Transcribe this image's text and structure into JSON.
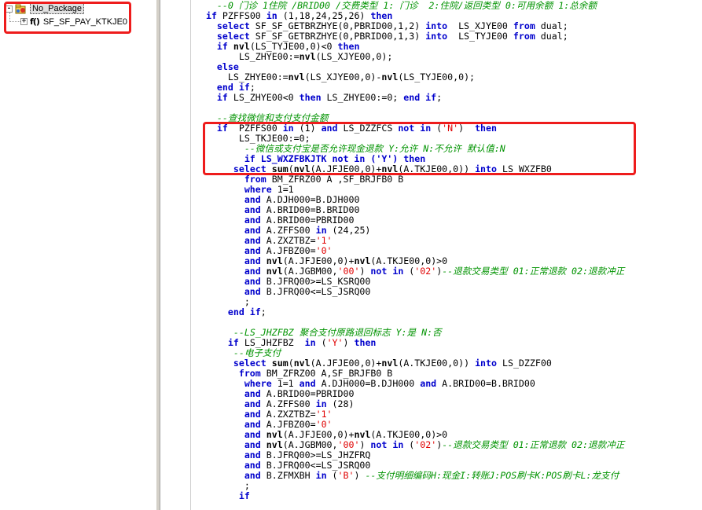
{
  "tree": {
    "package_label": "No_Package",
    "package_expander": "-",
    "procedure_expander": "+",
    "procedure_icon": "f()",
    "procedure_label": "SF_SF_PAY_KTKJE0"
  },
  "colors": {
    "highlight": "#ee1c1c",
    "keyword": "#0000cc",
    "string": "#e00000",
    "comment": "#009300"
  },
  "code_lines": [
    [
      [
        "    ",
        ""
      ],
      [
        "--0 门诊 1住院 /BRID00 /交费类型 1: 门诊  2:住院/返回类型 0:可用余额 1:总余额",
        "cm"
      ]
    ],
    [
      [
        "  ",
        ""
      ],
      [
        "if",
        "kw"
      ],
      [
        " PZFFS00 ",
        ""
      ],
      [
        "in",
        "kw"
      ],
      [
        " (1,18,24,25,26) ",
        ""
      ],
      [
        "then",
        "kw"
      ]
    ],
    [
      [
        "    ",
        ""
      ],
      [
        "select",
        "kw"
      ],
      [
        " SF_SF_GETBRZHYE(0,PBRID00,1,2) ",
        ""
      ],
      [
        "into",
        "kw"
      ],
      [
        "  LS_XJYE00 ",
        ""
      ],
      [
        "from",
        "kw"
      ],
      [
        " dual;",
        ""
      ]
    ],
    [
      [
        "    ",
        ""
      ],
      [
        "select",
        "kw"
      ],
      [
        " SF_SF_GETBRZHYE(0,PBRID00,1,3) ",
        ""
      ],
      [
        "into",
        "kw"
      ],
      [
        "  LS_TYJE00 ",
        ""
      ],
      [
        "from",
        "kw"
      ],
      [
        " dual;",
        ""
      ]
    ],
    [
      [
        "    ",
        ""
      ],
      [
        "if",
        "kw"
      ],
      [
        " ",
        ""
      ],
      [
        "nvl",
        "fn"
      ],
      [
        "(LS_TYJE00,0)<0 ",
        ""
      ],
      [
        "then",
        "kw"
      ]
    ],
    [
      [
        "        LS_ZHYE00:=",
        ""
      ],
      [
        "nvl",
        "fn"
      ],
      [
        "(LS_XJYE00,0);",
        ""
      ]
    ],
    [
      [
        "    ",
        ""
      ],
      [
        "else",
        "kw"
      ]
    ],
    [
      [
        "      LS_ZHYE00:=",
        ""
      ],
      [
        "nvl",
        "fn"
      ],
      [
        "(LS_XJYE00,0)-",
        ""
      ],
      [
        "nvl",
        "fn"
      ],
      [
        "(LS_TYJE00,0);",
        ""
      ]
    ],
    [
      [
        "    ",
        ""
      ],
      [
        "end if",
        "kw"
      ],
      [
        ";",
        ""
      ]
    ],
    [
      [
        "    ",
        ""
      ],
      [
        "if",
        "kw"
      ],
      [
        " LS_ZHYE00<0 ",
        ""
      ],
      [
        "then",
        "kw"
      ],
      [
        " LS_ZHYE00:=0; ",
        ""
      ],
      [
        "end if",
        "kw"
      ],
      [
        ";",
        ""
      ]
    ],
    [
      [
        "",
        ""
      ]
    ],
    [
      [
        "    ",
        ""
      ],
      [
        "--查找微信和支付支付金额",
        "cm"
      ]
    ],
    [
      [
        "    ",
        ""
      ],
      [
        "if",
        "kw"
      ],
      [
        "  PZFFS00 ",
        ""
      ],
      [
        "in",
        "kw"
      ],
      [
        " (1) ",
        ""
      ],
      [
        "and",
        "kw"
      ],
      [
        " LS_DZZFCS ",
        ""
      ],
      [
        "not in",
        "kw"
      ],
      [
        " (",
        ""
      ],
      [
        "'N'",
        "str"
      ],
      [
        ")  ",
        ""
      ],
      [
        "then",
        "kw"
      ]
    ],
    [
      [
        "        LS_TKJE00:=0;",
        ""
      ]
    ],
    [
      [
        "         ",
        ""
      ],
      [
        "--微信或支付宝是否允许现金退款 Y:允许 N:不允许 默认值:N",
        "cm"
      ]
    ],
    [
      [
        "         ",
        ""
      ],
      [
        "if LS_WXZFBKJTK not in ('Y') then",
        "kw"
      ]
    ],
    [
      [
        "       ",
        ""
      ],
      [
        "select",
        "kw"
      ],
      [
        " ",
        ""
      ],
      [
        "sum",
        "fn"
      ],
      [
        "(",
        ""
      ],
      [
        "nvl",
        "fn"
      ],
      [
        "(A.JFJE00,0)+",
        ""
      ],
      [
        "nvl",
        "fn"
      ],
      [
        "(A.TKJE00,0)) ",
        ""
      ],
      [
        "into",
        "kw"
      ],
      [
        " LS_WXZFB0",
        ""
      ]
    ],
    [
      [
        "         ",
        ""
      ],
      [
        "from",
        "kw"
      ],
      [
        " BM_ZFRZ00 A ,SF_BRJFB0 B",
        ""
      ]
    ],
    [
      [
        "         ",
        ""
      ],
      [
        "where",
        "kw"
      ],
      [
        " 1=1",
        ""
      ]
    ],
    [
      [
        "         ",
        ""
      ],
      [
        "and",
        "kw"
      ],
      [
        " A.DJH000=B.DJH000",
        ""
      ]
    ],
    [
      [
        "         ",
        ""
      ],
      [
        "and",
        "kw"
      ],
      [
        " A.BRID00=B.BRID00",
        ""
      ]
    ],
    [
      [
        "         ",
        ""
      ],
      [
        "and",
        "kw"
      ],
      [
        " A.BRID00=PBRID00",
        ""
      ]
    ],
    [
      [
        "         ",
        ""
      ],
      [
        "and",
        "kw"
      ],
      [
        " A.ZFFS00 ",
        ""
      ],
      [
        "in",
        "kw"
      ],
      [
        " (24,25)",
        ""
      ]
    ],
    [
      [
        "         ",
        ""
      ],
      [
        "and",
        "kw"
      ],
      [
        " A.ZXZTBZ=",
        ""
      ],
      [
        "'1'",
        "str"
      ]
    ],
    [
      [
        "         ",
        ""
      ],
      [
        "and",
        "kw"
      ],
      [
        " A.JFBZ00=",
        ""
      ],
      [
        "'0'",
        "str"
      ]
    ],
    [
      [
        "         ",
        ""
      ],
      [
        "and",
        "kw"
      ],
      [
        " ",
        ""
      ],
      [
        "nvl",
        "fn"
      ],
      [
        "(A.JFJE00,0)+",
        ""
      ],
      [
        "nvl",
        "fn"
      ],
      [
        "(A.TKJE00,0)>0",
        ""
      ]
    ],
    [
      [
        "         ",
        ""
      ],
      [
        "and",
        "kw"
      ],
      [
        " ",
        ""
      ],
      [
        "nvl",
        "fn"
      ],
      [
        "(A.JGBM00,",
        ""
      ],
      [
        "'00'",
        "str"
      ],
      [
        ") ",
        ""
      ],
      [
        "not in",
        "kw"
      ],
      [
        " (",
        ""
      ],
      [
        "'02'",
        "str"
      ],
      [
        ")",
        ""
      ],
      [
        "--退款交易类型 01:正常退款 02:退款冲正",
        "cm"
      ]
    ],
    [
      [
        "         ",
        ""
      ],
      [
        "and",
        "kw"
      ],
      [
        " B.JFRQ00>=LS_KSRQ00",
        ""
      ]
    ],
    [
      [
        "         ",
        ""
      ],
      [
        "and",
        "kw"
      ],
      [
        " B.JFRQ00<=LS_JSRQ00",
        ""
      ]
    ],
    [
      [
        "         ;",
        ""
      ]
    ],
    [
      [
        "      ",
        ""
      ],
      [
        "end if",
        "kw"
      ],
      [
        ";",
        ""
      ]
    ],
    [
      [
        "",
        ""
      ]
    ],
    [
      [
        "       ",
        ""
      ],
      [
        "--LS_JHZFBZ 聚合支付原路退回标志 Y:是 N:否",
        "cm"
      ]
    ],
    [
      [
        "      ",
        ""
      ],
      [
        "if",
        "kw"
      ],
      [
        " LS_JHZFBZ  ",
        ""
      ],
      [
        "in",
        "kw"
      ],
      [
        " (",
        ""
      ],
      [
        "'Y'",
        "str"
      ],
      [
        ") ",
        ""
      ],
      [
        "then",
        "kw"
      ]
    ],
    [
      [
        "       ",
        ""
      ],
      [
        "--电子支付",
        "cm"
      ]
    ],
    [
      [
        "       ",
        ""
      ],
      [
        "select",
        "kw"
      ],
      [
        " ",
        ""
      ],
      [
        "sum",
        "fn"
      ],
      [
        "(",
        ""
      ],
      [
        "nvl",
        "fn"
      ],
      [
        "(A.JFJE00,0)+",
        ""
      ],
      [
        "nvl",
        "fn"
      ],
      [
        "(A.TKJE00,0)) ",
        ""
      ],
      [
        "into",
        "kw"
      ],
      [
        " LS_DZZF00",
        ""
      ]
    ],
    [
      [
        "        ",
        ""
      ],
      [
        "from",
        "kw"
      ],
      [
        " BM_ZFRZ00 A,SF_BRJFB0 B",
        ""
      ]
    ],
    [
      [
        "         ",
        ""
      ],
      [
        "where",
        "kw"
      ],
      [
        " 1=1 ",
        ""
      ],
      [
        "and",
        "kw"
      ],
      [
        " A.DJH000=B.DJH000 ",
        ""
      ],
      [
        "and",
        "kw"
      ],
      [
        " A.BRID00=B.BRID00",
        ""
      ]
    ],
    [
      [
        "         ",
        ""
      ],
      [
        "and",
        "kw"
      ],
      [
        " A.BRID00=PBRID00",
        ""
      ]
    ],
    [
      [
        "         ",
        ""
      ],
      [
        "and",
        "kw"
      ],
      [
        " A.ZFFS00 ",
        ""
      ],
      [
        "in",
        "kw"
      ],
      [
        " (28)",
        ""
      ]
    ],
    [
      [
        "         ",
        ""
      ],
      [
        "and",
        "kw"
      ],
      [
        " A.ZXZTBZ=",
        ""
      ],
      [
        "'1'",
        "str"
      ]
    ],
    [
      [
        "         ",
        ""
      ],
      [
        "and",
        "kw"
      ],
      [
        " A.JFBZ00=",
        ""
      ],
      [
        "'0'",
        "str"
      ]
    ],
    [
      [
        "         ",
        ""
      ],
      [
        "and",
        "kw"
      ],
      [
        " ",
        ""
      ],
      [
        "nvl",
        "fn"
      ],
      [
        "(A.JFJE00,0)+",
        ""
      ],
      [
        "nvl",
        "fn"
      ],
      [
        "(A.TKJE00,0)>0",
        ""
      ]
    ],
    [
      [
        "         ",
        ""
      ],
      [
        "and",
        "kw"
      ],
      [
        " ",
        ""
      ],
      [
        "nvl",
        "fn"
      ],
      [
        "(A.JGBM00,",
        ""
      ],
      [
        "'00'",
        "str"
      ],
      [
        ") ",
        ""
      ],
      [
        "not in",
        "kw"
      ],
      [
        " (",
        ""
      ],
      [
        "'02'",
        "str"
      ],
      [
        ")",
        ""
      ],
      [
        "--退款交易类型 01:正常退款 02:退款冲正",
        "cm"
      ]
    ],
    [
      [
        "         ",
        ""
      ],
      [
        "and",
        "kw"
      ],
      [
        " B.JFRQ00>=LS_JHZFRQ",
        ""
      ]
    ],
    [
      [
        "         ",
        ""
      ],
      [
        "and",
        "kw"
      ],
      [
        " B.JFRQ00<=LS_JSRQ00",
        ""
      ]
    ],
    [
      [
        "         ",
        ""
      ],
      [
        "and",
        "kw"
      ],
      [
        " B.ZFMXBH ",
        ""
      ],
      [
        "in",
        "kw"
      ],
      [
        " (",
        ""
      ],
      [
        "'B'",
        "str"
      ],
      [
        ") ",
        ""
      ],
      [
        "--支付明细编码H:现金I:转账J:POS刷卡K:POS刷卡L:龙支付",
        "cm"
      ]
    ],
    [
      [
        "         ;",
        ""
      ]
    ],
    [
      [
        "        ",
        ""
      ],
      [
        "if",
        "kw"
      ]
    ]
  ]
}
